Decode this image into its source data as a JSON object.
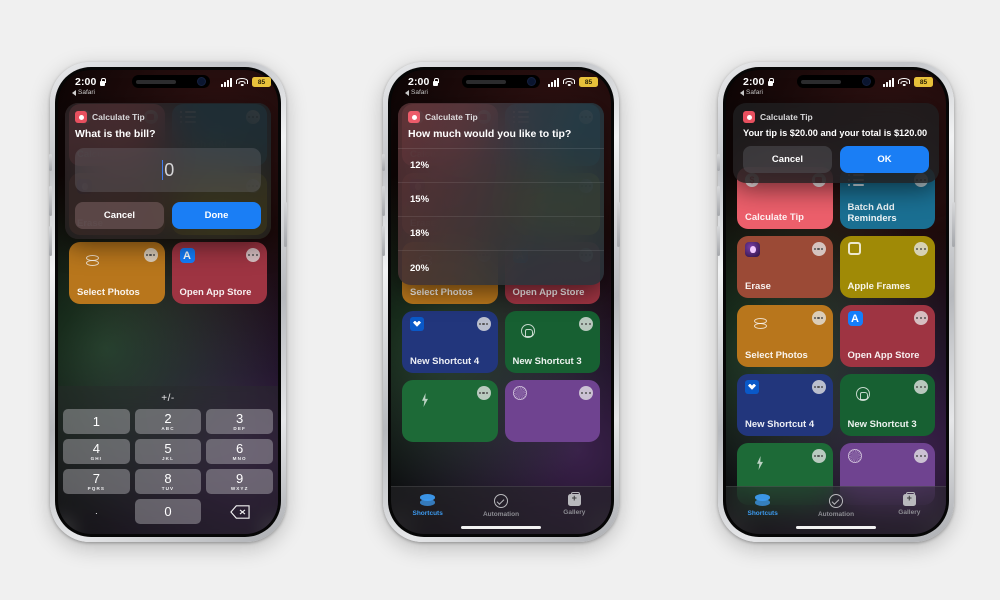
{
  "page": {
    "background": "#f0f0f0",
    "accent": "#1a7ef5",
    "app_color": "#e8505f"
  },
  "status_bar": {
    "time": "2:00",
    "back_app": "Safari",
    "battery": "85",
    "lock_icon": "lock-icon",
    "signal_icon": "cellular-signal-icon",
    "wifi_icon": "wifi-icon",
    "battery_icon": "battery-low-power-icon"
  },
  "phones": [
    {
      "id": "phone-1",
      "name": "phone-ask-for-bill",
      "sheet": {
        "type": "input",
        "app_title": "Calculate Tip",
        "question": "What is the bill?",
        "input_value": "0",
        "cancel_label": "Cancel",
        "confirm_label": "Done"
      },
      "keypad": {
        "toggle_label": "+/-",
        "keys": [
          {
            "num": "1",
            "sub": ""
          },
          {
            "num": "2",
            "sub": "ABC"
          },
          {
            "num": "3",
            "sub": "DEF"
          },
          {
            "num": "4",
            "sub": "GHI"
          },
          {
            "num": "5",
            "sub": "JKL"
          },
          {
            "num": "6",
            "sub": "MNO"
          },
          {
            "num": "7",
            "sub": "PQRS"
          },
          {
            "num": "8",
            "sub": "TUV"
          },
          {
            "num": "9",
            "sub": "WXYZ"
          },
          {
            "num": ".",
            "sub": ""
          },
          {
            "num": "0",
            "sub": ""
          }
        ],
        "delete_icon": "delete-backward-icon"
      }
    },
    {
      "id": "phone-2",
      "name": "phone-choose-tip",
      "sheet": {
        "type": "list",
        "app_title": "Calculate Tip",
        "question": "How much would you like to tip?",
        "options": [
          "12%",
          "15%",
          "18%",
          "20%"
        ]
      }
    },
    {
      "id": "phone-3",
      "name": "phone-tip-result",
      "sheet": {
        "type": "alert",
        "app_title": "Calculate Tip",
        "question": "Your tip is $20.00 and your total is $120.00",
        "cancel_label": "Cancel",
        "confirm_label": "OK"
      }
    }
  ],
  "shortcuts": [
    {
      "label": "Calculate Tip",
      "color": "#ec5f6b",
      "icon": "dollar-circle-icon",
      "badge": "message-icon"
    },
    {
      "label": "Batch Add Reminders",
      "color": "#1a6f92",
      "icon": "list-icon",
      "badge": "more-icon"
    },
    {
      "label": "Erase",
      "color": "#9b4a36",
      "icon": "erase-app-icon",
      "badge": "more-icon"
    },
    {
      "label": "Apple Frames",
      "color": "#a08a06",
      "icon": "square-icon",
      "badge": "more-icon"
    },
    {
      "label": "Select Photos",
      "color": "#b8761c",
      "icon": "photos-stack-icon",
      "badge": "more-icon"
    },
    {
      "label": "Open App Store",
      "color": "#9e3442",
      "icon": "app-store-icon",
      "badge": "more-icon"
    },
    {
      "label": "New Shortcut 4",
      "color": "#22367c",
      "icon": "dropbox-icon",
      "badge": "more-icon"
    },
    {
      "label": "New Shortcut 3",
      "color": "#176032",
      "icon": "whatsapp-icon",
      "badge": "more-icon"
    },
    {
      "label": "",
      "color": "#1d6a37",
      "icon": "bolt-icon",
      "badge": "more-icon"
    },
    {
      "label": "",
      "color": "#6f4390",
      "icon": "fan-icon",
      "badge": "more-icon"
    }
  ],
  "tab_bar": {
    "items": [
      {
        "label": "Shortcuts",
        "icon": "shortcuts-icon",
        "active": true
      },
      {
        "label": "Automation",
        "icon": "automation-icon",
        "active": false
      },
      {
        "label": "Gallery",
        "icon": "gallery-icon",
        "active": false
      }
    ]
  }
}
